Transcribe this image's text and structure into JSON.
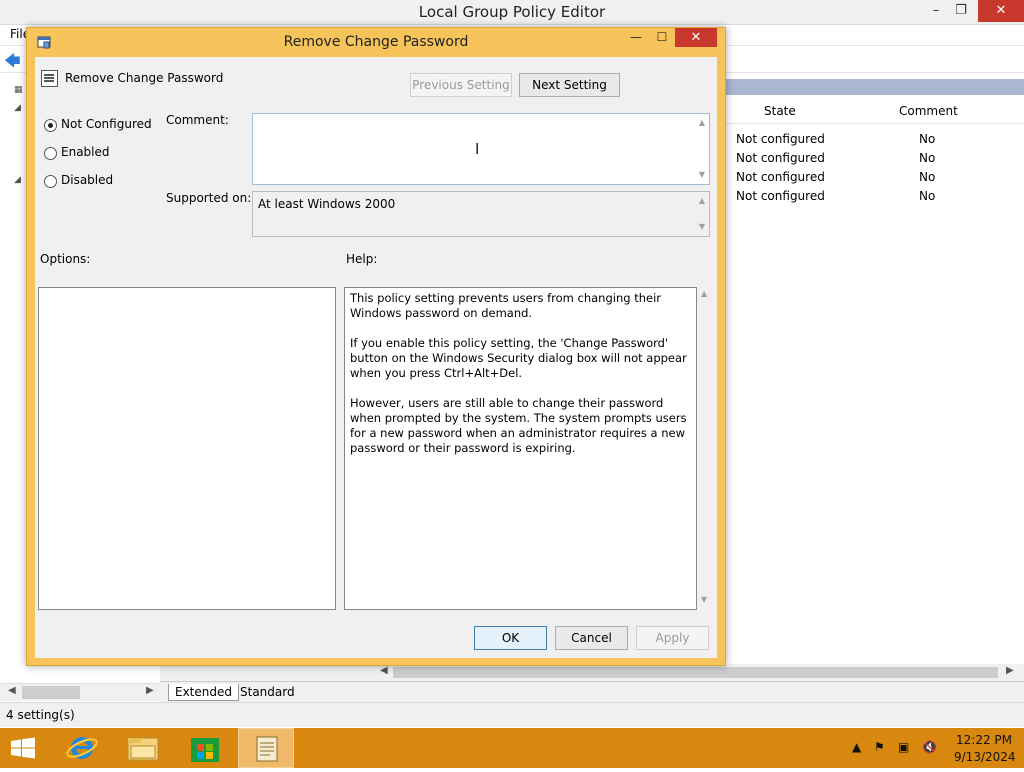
{
  "main_window": {
    "title": "Local Group Policy Editor",
    "menu": {
      "file": "File"
    },
    "controls": {
      "minimize": "–",
      "maximize": "❐",
      "close": "✕"
    },
    "list": {
      "columns": [
        "State",
        "Comment"
      ],
      "rows": [
        {
          "state": "Not configured",
          "comment": "No"
        },
        {
          "state": "Not configured",
          "comment": "No"
        },
        {
          "state": "Not configured",
          "comment": "No"
        },
        {
          "state": "Not configured",
          "comment": "No"
        }
      ]
    },
    "view_tabs": {
      "extended": "Extended",
      "standard": "Standard"
    },
    "status": "4 setting(s)"
  },
  "dialog": {
    "title": "Remove Change Password",
    "controls": {
      "minimize": "—",
      "maximize": "☐",
      "close": "✕"
    },
    "setting_name": "Remove Change Password",
    "buttons": {
      "previous": "Previous Setting",
      "next": "Next Setting",
      "ok": "OK",
      "cancel": "Cancel",
      "apply": "Apply"
    },
    "radios": {
      "not_configured": "Not Configured",
      "enabled": "Enabled",
      "disabled": "Disabled",
      "selected": "not_configured"
    },
    "labels": {
      "comment": "Comment:",
      "supported_on": "Supported on:",
      "options": "Options:",
      "help": "Help:"
    },
    "comment_value": "",
    "supported_on_value": "At least Windows 2000",
    "help": {
      "p1": "This policy setting prevents users from changing their Windows password on demand.",
      "p2": "If you enable this policy setting,  the 'Change Password' button on the Windows Security dialog box will not appear when you press Ctrl+Alt+Del.",
      "p3": "However, users are still able to change their password when prompted by the system. The system prompts users for a new password when an administrator requires a new password or their password is expiring."
    }
  },
  "taskbar": {
    "time": "12:22 PM",
    "date": "9/13/2024",
    "apps": [
      "start-icon",
      "internet-explorer-icon",
      "file-explorer-icon",
      "store-icon",
      "group-policy-icon"
    ],
    "colors": {
      "taskbar": "#d9880f",
      "dialog_frame": "#f6c45a"
    }
  }
}
